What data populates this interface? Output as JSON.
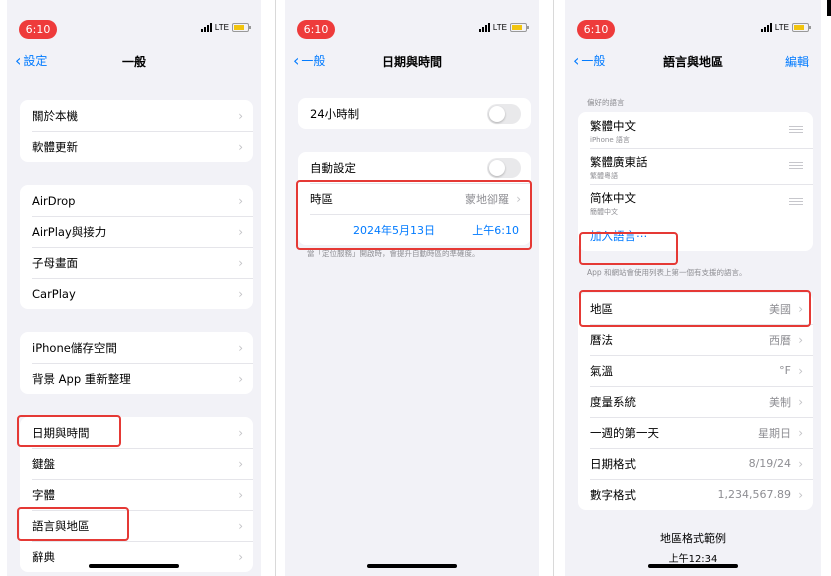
{
  "status": {
    "time": "6:10",
    "network": "LTE"
  },
  "panel1": {
    "back_label": "設定",
    "title": "一般",
    "groups": [
      [
        "關於本機",
        "軟體更新"
      ],
      [
        "AirDrop",
        "AirPlay與接力",
        "子母畫面",
        "CarPlay"
      ],
      [
        "iPhone儲存空間",
        "背景 App 重新整理"
      ],
      [
        "日期與時間",
        "鍵盤",
        "字體",
        "語言與地區",
        "辭典"
      ]
    ]
  },
  "panel2": {
    "back_label": "一般",
    "title": "日期與時間",
    "hour24_label": "24小時制",
    "auto_set_label": "自動設定",
    "timezone_label": "時區",
    "timezone_value": "蒙地卻羅",
    "date_value": "2024年5月13日",
    "time_value": "上午6:10",
    "footnote": "當「定位服務」開啟時，會提升自動時區的準確度。"
  },
  "panel3": {
    "back_label": "一般",
    "title": "語言與地區",
    "edit_label": "編輯",
    "preferred_header": "偏好的語言",
    "languages": [
      {
        "name": "繁體中文",
        "sub": "iPhone 語言"
      },
      {
        "name": "繁體廣東話",
        "sub": "繁體粵語"
      },
      {
        "name": "简体中文",
        "sub": "簡體中文"
      }
    ],
    "add_language": "加入語言⋯",
    "lang_footnote": "App 和網站會使用列表上第一個有支援的語言。",
    "rows": [
      {
        "label": "地區",
        "value": "美國"
      },
      {
        "label": "曆法",
        "value": "西曆"
      },
      {
        "label": "氣溫",
        "value": "°F"
      },
      {
        "label": "度量系統",
        "value": "美制"
      },
      {
        "label": "一週的第一天",
        "value": "星期日"
      },
      {
        "label": "日期格式",
        "value": "8/19/24"
      },
      {
        "label": "數字格式",
        "value": "1,234,567.89"
      }
    ],
    "preview_title": "地區格式範例",
    "preview_time": "上午12:34"
  },
  "colors": {
    "accent": "#007aff",
    "highlight": "#e53935",
    "background": "#f2f2f7"
  }
}
